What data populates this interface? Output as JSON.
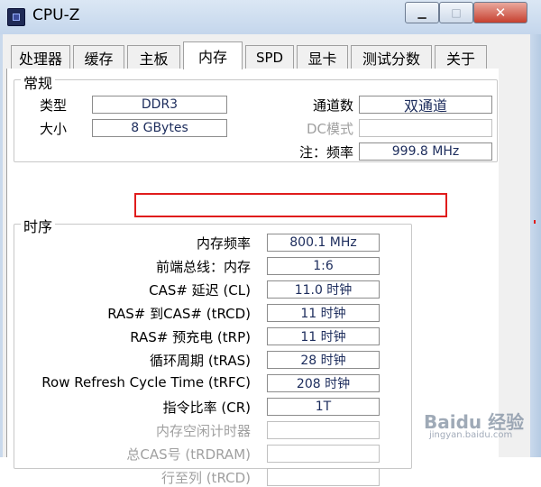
{
  "window": {
    "title": "CPU-Z",
    "minimize_glyph": "▁",
    "maximize_glyph": "□",
    "close_glyph": "✕"
  },
  "tabs": [
    "处理器",
    "缓存",
    "主板",
    "内存",
    "SPD",
    "显卡",
    "测试分数",
    "关于"
  ],
  "active_tab": "内存",
  "general": {
    "group_label": "常规",
    "type_label": "类型",
    "type_value": "DDR3",
    "size_label": "大小",
    "size_value": "8 GBytes",
    "channels_label": "通道数",
    "channels_value": "双通道",
    "dc_mode_label": "DC模式",
    "dc_mode_value": "",
    "note_label": "注：频率",
    "note_value": "999.8 MHz"
  },
  "timings": {
    "group_label": "时序",
    "rows": [
      {
        "label": "内存频率",
        "value": "800.1 MHz",
        "disabled": false
      },
      {
        "label": "前端总线：内存",
        "value": "1:6",
        "disabled": false
      },
      {
        "label": "CAS# 延迟 (CL)",
        "value": "11.0 时钟",
        "disabled": false
      },
      {
        "label": "RAS# 到CAS# (tRCD)",
        "value": "11 时钟",
        "disabled": false
      },
      {
        "label": "RAS# 预充电 (tRP)",
        "value": "11 时钟",
        "disabled": false
      },
      {
        "label": "循环周期 (tRAS)",
        "value": "28 时钟",
        "disabled": false
      },
      {
        "label": "Row Refresh Cycle Time (tRFC)",
        "value": "208 时钟",
        "disabled": false
      },
      {
        "label": "指令比率 (CR)",
        "value": "1T",
        "disabled": false
      },
      {
        "label": "内存空闲计时器",
        "value": "",
        "disabled": true
      },
      {
        "label": "总CAS号 (tRDRAM)",
        "value": "",
        "disabled": true
      },
      {
        "label": "行至列 (tRCD)",
        "value": "",
        "disabled": true
      }
    ]
  },
  "watermark": {
    "text": "Baidu 经验",
    "sub": "jingyan.baidu.com"
  },
  "colors": {
    "highlight_box": "#e01c1c",
    "value_text": "#1c2c5c"
  }
}
